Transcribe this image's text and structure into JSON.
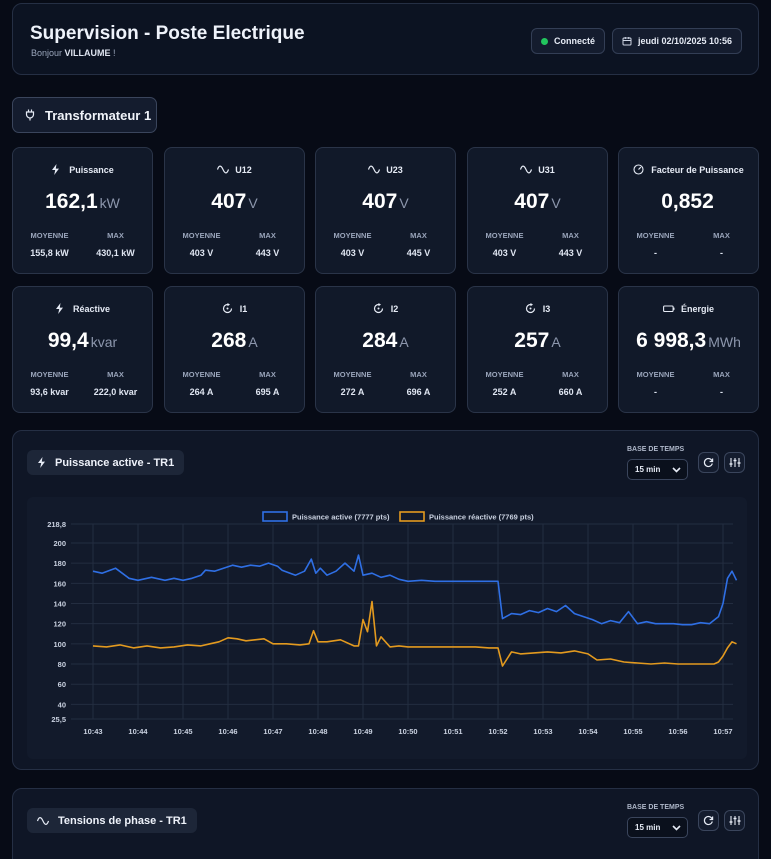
{
  "header": {
    "title": "Supervision - Poste Electrique",
    "greeting_prefix": "Bonjour",
    "user": "VILLAUME",
    "greeting_suffix": " !",
    "status": "Connecté",
    "datetime": "jeudi 02/10/2025 10:56"
  },
  "transformer_tab": "Transformateur 1",
  "cards": [
    {
      "label": "Puissance",
      "icon": "bolt-icon",
      "value": "162,1",
      "unit": "kW",
      "avg_label": "MOYENNE",
      "max_label": "MAX",
      "avg": "155,8 kW",
      "max": "430,1 kW"
    },
    {
      "label": "U12",
      "icon": "wave-icon",
      "value": "407",
      "unit": "V",
      "avg_label": "MOYENNE",
      "max_label": "MAX",
      "avg": "403 V",
      "max": "443 V"
    },
    {
      "label": "U23",
      "icon": "wave-icon",
      "value": "407",
      "unit": "V",
      "avg_label": "MOYENNE",
      "max_label": "MAX",
      "avg": "403 V",
      "max": "445 V"
    },
    {
      "label": "U31",
      "icon": "wave-icon",
      "value": "407",
      "unit": "V",
      "avg_label": "MOYENNE",
      "max_label": "MAX",
      "avg": "403 V",
      "max": "443 V"
    },
    {
      "label": "Facteur de Puissance",
      "icon": "gauge-icon",
      "value": "0,852",
      "unit": "",
      "avg_label": "MOYENNE",
      "max_label": "MAX",
      "avg": "-",
      "max": "-"
    },
    {
      "label": "Réactive",
      "icon": "bolt-icon",
      "value": "99,4",
      "unit": "kvar",
      "avg_label": "MOYENNE",
      "max_label": "MAX",
      "avg": "93,6 kvar",
      "max": "222,0 kvar"
    },
    {
      "label": "I1",
      "icon": "current-icon",
      "value": "268",
      "unit": "A",
      "avg_label": "MOYENNE",
      "max_label": "MAX",
      "avg": "264 A",
      "max": "695 A"
    },
    {
      "label": "I2",
      "icon": "current-icon",
      "value": "284",
      "unit": "A",
      "avg_label": "MOYENNE",
      "max_label": "MAX",
      "avg": "272 A",
      "max": "696 A"
    },
    {
      "label": "I3",
      "icon": "current-icon",
      "value": "257",
      "unit": "A",
      "avg_label": "MOYENNE",
      "max_label": "MAX",
      "avg": "252 A",
      "max": "660 A"
    },
    {
      "label": "Énergie",
      "icon": "battery-icon",
      "value": "6 998,3",
      "unit": "MWh",
      "avg_label": "MOYENNE",
      "max_label": "MAX",
      "avg": "-",
      "max": "-"
    }
  ],
  "power_panel": {
    "title": "Puissance active - TR1",
    "base_label": "BASE DE TEMPS",
    "base_value": "15 min"
  },
  "tension_panel": {
    "title": "Tensions de phase - TR1",
    "base_label": "BASE DE TEMPS",
    "base_value": "15 min"
  },
  "colors": {
    "active": "#2f6fe4",
    "reactive": "#e39a1f",
    "status_ok": "#22c55e"
  },
  "chart_data": {
    "type": "line",
    "title": "",
    "xlabel": "",
    "ylabel": "",
    "ylim": [
      25.5,
      218.8
    ],
    "y_ticks": [
      "218,8",
      "200",
      "180",
      "160",
      "140",
      "120",
      "100",
      "80",
      "60",
      "40",
      "25,5"
    ],
    "x_ticks": [
      "10:43",
      "10:44",
      "10:45",
      "10:46",
      "10:47",
      "10:48",
      "10:49",
      "10:50",
      "10:51",
      "10:52",
      "10:53",
      "10:54",
      "10:55",
      "10:56",
      "10:57"
    ],
    "grid": true,
    "legend_position": "top",
    "series": [
      {
        "name": "Puissance active (7777 pts)",
        "color": "#2f6fe4",
        "x": [
          0,
          0.2,
          0.5,
          0.8,
          1.0,
          1.3,
          1.6,
          1.8,
          2.0,
          2.2,
          2.4,
          2.5,
          2.7,
          2.9,
          3.1,
          3.3,
          3.5,
          3.7,
          3.9,
          4.1,
          4.2,
          4.5,
          4.7,
          4.85,
          4.95,
          5.05,
          5.2,
          5.4,
          5.6,
          5.8,
          5.9,
          6.0,
          6.2,
          6.4,
          6.6,
          6.8,
          7.0,
          7.3,
          7.6,
          7.9,
          8.2,
          8.5,
          8.8,
          9.0,
          9.1,
          9.3,
          9.5,
          9.7,
          9.9,
          10.1,
          10.3,
          10.5,
          10.7,
          10.9,
          11.1,
          11.3,
          11.5,
          11.7,
          11.9,
          12.1,
          12.3,
          12.5,
          12.7,
          12.9,
          13.1,
          13.3,
          13.5,
          13.7,
          13.9,
          14.0,
          14.1,
          14.2,
          14.3
        ],
        "y": [
          172,
          170,
          175,
          165,
          163,
          166,
          163,
          165,
          163,
          165,
          168,
          173,
          172,
          175,
          178,
          176,
          178,
          177,
          180,
          177,
          173,
          168,
          172,
          184,
          170,
          175,
          168,
          172,
          180,
          172,
          188,
          168,
          170,
          166,
          168,
          164,
          162,
          163,
          162,
          162,
          162,
          162,
          162,
          162,
          125,
          130,
          129,
          133,
          131,
          135,
          132,
          138,
          130,
          127,
          124,
          120,
          123,
          121,
          132,
          120,
          122,
          120,
          120,
          120,
          119,
          119,
          121,
          120,
          127,
          140,
          165,
          172,
          163
        ]
      },
      {
        "name": "Puissance réactive (7769 pts)",
        "color": "#e39a1f",
        "x": [
          0,
          0.3,
          0.6,
          0.9,
          1.2,
          1.5,
          1.8,
          2.1,
          2.4,
          2.6,
          2.8,
          3.0,
          3.2,
          3.4,
          3.6,
          3.8,
          4.0,
          4.3,
          4.6,
          4.8,
          4.9,
          5.0,
          5.2,
          5.5,
          5.8,
          5.9,
          6.0,
          6.1,
          6.2,
          6.3,
          6.4,
          6.6,
          6.8,
          7.0,
          7.3,
          7.6,
          7.9,
          8.2,
          8.5,
          8.8,
          9.0,
          9.1,
          9.3,
          9.5,
          9.8,
          10.1,
          10.4,
          10.7,
          10.9,
          11.0,
          11.2,
          11.5,
          11.8,
          12.1,
          12.4,
          12.7,
          13.0,
          13.3,
          13.6,
          13.8,
          13.9,
          14.0,
          14.1,
          14.2,
          14.3
        ],
        "y": [
          98,
          97,
          99,
          96,
          98,
          96,
          97,
          99,
          98,
          100,
          102,
          106,
          105,
          103,
          104,
          105,
          100,
          100,
          99,
          100,
          113,
          102,
          102,
          104,
          98,
          98,
          124,
          112,
          142,
          98,
          107,
          97,
          98,
          97,
          97,
          97,
          97,
          97,
          97,
          96,
          96,
          78,
          92,
          90,
          91,
          92,
          91,
          93,
          91,
          90,
          84,
          85,
          82,
          81,
          80,
          81,
          80,
          80,
          80,
          80,
          82,
          88,
          96,
          102,
          100
        ]
      }
    ]
  }
}
